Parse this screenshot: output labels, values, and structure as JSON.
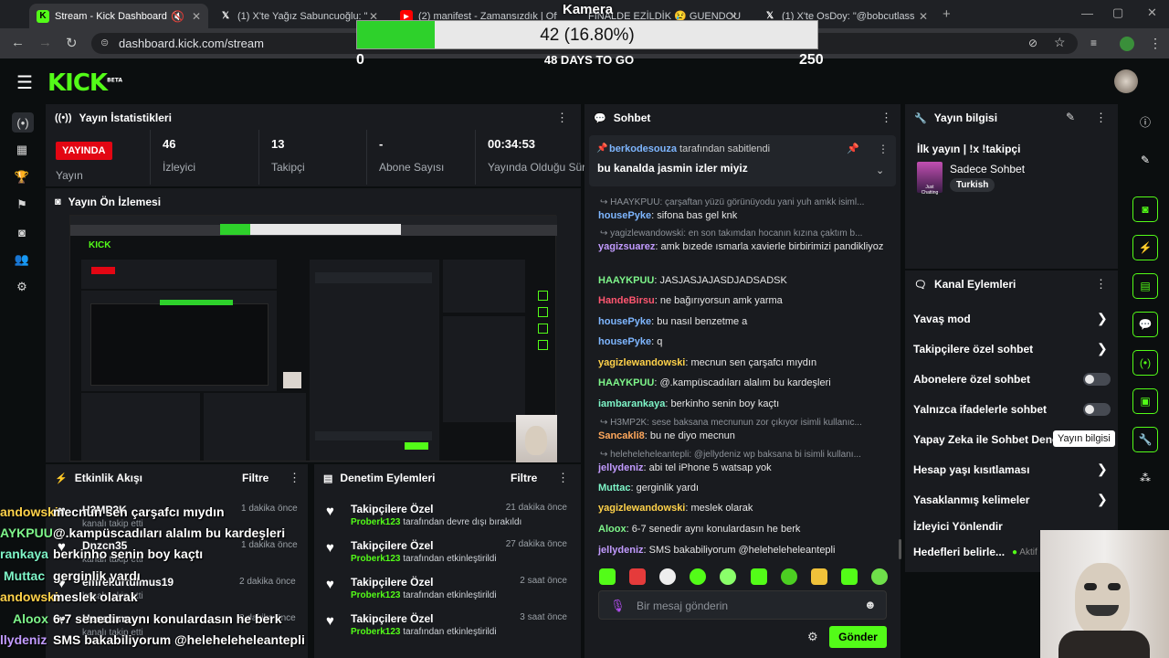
{
  "browser": {
    "tabs": [
      {
        "title": "Stream - Kick Dashboard",
        "icon": "kick-icon"
      },
      {
        "title": "(1) X'te Yağız Sabuncuoğlu: \"",
        "icon": "x-icon"
      },
      {
        "title": "(2) manifest - Zamansızdık | Off",
        "icon": "youtube-icon"
      },
      {
        "title": "FİNALDE EZİLDİK 😢 GUENDOU",
        "icon": "youtube-icon"
      },
      {
        "title": "(1) X'te OsDoy: \"@bobcutlass",
        "icon": "x-icon"
      }
    ],
    "url": "dashboard.kick.com/stream"
  },
  "overlay": {
    "camera_label": "Kamera",
    "goal_text": "42 (16.80%)",
    "goal_progress": 0.168,
    "goal_min": "0",
    "goal_max": "250",
    "days_left": "48 DAYS TO GO"
  },
  "header": {
    "logo": "KICK",
    "beta": "BETA"
  },
  "stats": {
    "title": "Yayın İstatistikleri",
    "live_badge": "YAYINDA",
    "live_label": "Yayın",
    "viewers_value": "46",
    "viewers_label": "İzleyici",
    "followers_value": "13",
    "followers_label": "Takipçi",
    "subs_value": "-",
    "subs_label": "Abone Sayısı",
    "uptime_value": "00:34:53",
    "uptime_label": "Yayında Olduğu Süre"
  },
  "preview": {
    "title": "Yayın Ön İzlemesi"
  },
  "activity": {
    "title": "Etkinlik Akışı",
    "filter": "Filtre",
    "items": [
      {
        "name": "H3MP2K",
        "sub": "kanalı takip etti",
        "time": "1 dakika önce"
      },
      {
        "name": "Dnzcn35",
        "sub": "kanalı takip etti",
        "time": "1 dakika önce"
      },
      {
        "name": "emrekurtulmus19",
        "sub": "kanalı takip etti",
        "time": "2 dakika önce"
      },
      {
        "name": "Hesabım",
        "sub": "kanalı takip etti",
        "time": "2 dakika önce"
      }
    ]
  },
  "moderation": {
    "title": "Denetim Eylemleri",
    "filter": "Filtre",
    "items": [
      {
        "title": "Takipçilere Özel",
        "user": "Proberk123",
        "action": "tarafından devre dışı bırakıldı",
        "time": "21 dakika önce"
      },
      {
        "title": "Takipçilere Özel",
        "user": "Proberk123",
        "action": "tarafından etkinleştirildi",
        "time": "27 dakika önce"
      },
      {
        "title": "Takipçilere Özel",
        "user": "Proberk123",
        "action": "tarafından etkinleştirildi",
        "time": "2 saat önce"
      },
      {
        "title": "Takipçilere Özel",
        "user": "Proberk123",
        "action": "tarafından etkinleştirildi",
        "time": "3 saat önce"
      }
    ]
  },
  "chat": {
    "title": "Sohbet",
    "pinned_user": "berkodesouza",
    "pinned_suffix": "tarafından sabitlendi",
    "pinned_message": "bu kanalda jasmin izler miyiz",
    "placeholder": "Bir mesaj gönderin",
    "send": "Gönder",
    "replies": [
      "HAAYKPUU: çarşaftan yüzü görünüyodu yani yuh amkk isiml...",
      "yagizlewandowski: en son takımdan hocanın kızına çaktım b...",
      "H3MP2K: sese baksana mecnunun zor çıkıyor isimli kullanıc...",
      "heleheleheleantepli: @jellydeniz wp baksana bi isimli kullanı..."
    ],
    "messages": [
      {
        "user": "housePyke",
        "text": "sifona bas gel knk",
        "color": "#7eb6ff"
      },
      {
        "user": "yagizsuarez",
        "text": "amk bızede ısmarla xavierle birbirimizi pandikliyoz",
        "color": "#c29bff"
      },
      {
        "user": "HAAYKPUU",
        "text": "JASJASJAJASDJADSADSK",
        "color": "#7ef58a"
      },
      {
        "user": "HandeBirsu",
        "text": "ne bağırıyorsun amk yarma",
        "color": "#ff5670"
      },
      {
        "user": "housePyke",
        "text": "bu nasıl benzetme a",
        "color": "#7eb6ff"
      },
      {
        "user": "housePyke",
        "text": "q",
        "color": "#7eb6ff"
      },
      {
        "user": "yagizlewandowski",
        "text": "mecnun sen çarşafcı mıydın",
        "color": "#ffd24a"
      },
      {
        "user": "HAAYKPUU",
        "text": "@.kampüscadıları alalım bu kardeşleri",
        "color": "#7ef58a"
      },
      {
        "user": "iambarankaya",
        "text": "berkinho senin boy kaçtı",
        "color": "#7ef5c8"
      },
      {
        "user": "Sancakli8",
        "text": "bu ne diyo mecnun",
        "color": "#ffa85c"
      },
      {
        "user": "jellydeniz",
        "text": "abi tel iPhone 5 watsap yok",
        "color": "#c29bff"
      },
      {
        "user": "Muttac",
        "text": "gerginlik yardı",
        "color": "#7ef5c8"
      },
      {
        "user": "yagizlewandowski",
        "text": "meslek olarak",
        "color": "#ffd24a"
      },
      {
        "user": "Aloox",
        "text": "6-7 senedir aynı konulardasın he berk",
        "color": "#7ef58a"
      },
      {
        "user": "jellydeniz",
        "text": "SMS bakabiliyorum @heleheleheleantepli",
        "color": "#c29bff"
      }
    ]
  },
  "stream_info": {
    "title": "Yayın bilgisi",
    "stream_title": "İlk yayın | !x !takipçi",
    "category": "Sadece Sohbet",
    "category_art": "Just Chatting",
    "language": "Turkish"
  },
  "channel_actions": {
    "title": "Kanal Eylemleri",
    "items": [
      {
        "label": "Yavaş mod",
        "kind": "chevron"
      },
      {
        "label": "Takipçilere özel sohbet",
        "kind": "chevron"
      },
      {
        "label": "Abonelere özel sohbet",
        "kind": "toggle"
      },
      {
        "label": "Yalnızca ifadelerle sohbet",
        "kind": "toggle"
      },
      {
        "label": "Yapay Zeka ile Sohbet Denetimi",
        "kind": "chevron"
      },
      {
        "label": "Hesap yaşı kısıtlaması",
        "kind": "chevron"
      },
      {
        "label": "Yasaklanmış kelimeler",
        "kind": "chevron"
      },
      {
        "label": "İzleyici Yönlendir",
        "kind": "none"
      },
      {
        "label": "Hedefleri belirle...",
        "kind": "none"
      }
    ],
    "active_label": "Aktif",
    "tooltip": "Yayın bilgisi"
  },
  "overlay_chat": {
    "names": [
      {
        "text": "andowski",
        "color": "#ffd24a"
      },
      {
        "text": "AYKPUU",
        "color": "#7ef58a"
      },
      {
        "text": "rankaya",
        "color": "#7ef5c8"
      },
      {
        "text": "Muttac",
        "color": "#7ef5c8"
      },
      {
        "text": "andowski",
        "color": "#ffd24a"
      },
      {
        "text": "Aloox",
        "color": "#7ef58a"
      },
      {
        "text": "llydeniz",
        "color": "#c29bff"
      }
    ],
    "lines": [
      "mecnun sen çarşafcı mıydın",
      "@.kampüscadıları alalım bu kardeşleri",
      "berkinho senin boy kaçtı",
      "gerginlik yardı",
      "meslek olarak",
      "6-7 senedir aynı konulardasın he berk",
      "SMS bakabiliyorum @heleheleheleantepli"
    ]
  },
  "colors": {
    "brand": "#53fc18",
    "live": "#e30613",
    "panel": "#191b1f"
  }
}
